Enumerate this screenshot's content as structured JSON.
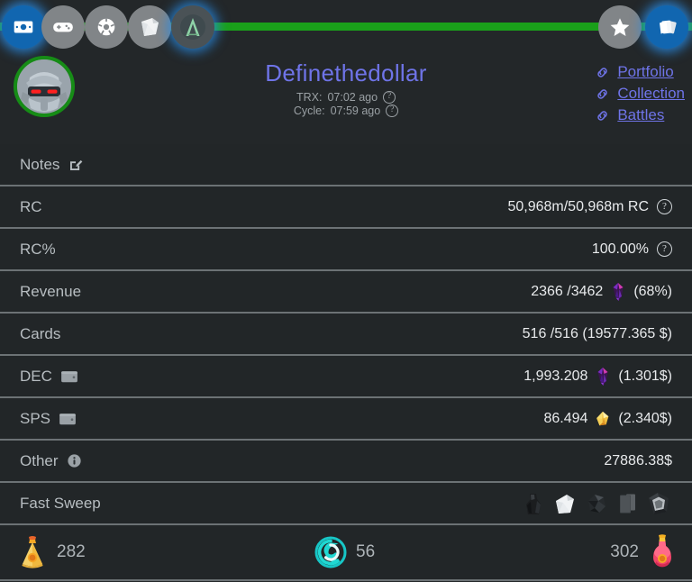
{
  "topbar": {
    "progress_percent": 100,
    "left_icons": [
      {
        "name": "money-icon",
        "label": "Money",
        "state": "active"
      },
      {
        "name": "gamepad-icon",
        "label": "Game",
        "state": "normal"
      },
      {
        "name": "ball-icon",
        "label": "Ball",
        "state": "normal"
      },
      {
        "name": "pack-icon",
        "label": "Pack",
        "state": "normal"
      },
      {
        "name": "alpha-icon",
        "label": "Alpha",
        "state": "glow"
      }
    ],
    "right_icons": [
      {
        "name": "star-icon",
        "label": "Star",
        "state": "normal"
      },
      {
        "name": "cards-icon",
        "label": "Cards",
        "state": "active"
      }
    ]
  },
  "header": {
    "username": "Definethedollar",
    "trx_label": "TRX:",
    "trx_value": "07:02 ago",
    "cycle_label": "Cycle:",
    "cycle_value": "07:59 ago",
    "help_glyph": "?",
    "links": [
      {
        "label": "Portfolio"
      },
      {
        "label": "Collection"
      },
      {
        "label": "Battles"
      }
    ]
  },
  "rows": [
    {
      "label": "Notes",
      "value": ""
    },
    {
      "label": "RC",
      "value": "50,968m/50,968m RC"
    },
    {
      "label": "RC%",
      "value": "100.00%"
    },
    {
      "label": "Revenue",
      "value_pre": "2366 /3462",
      "value_post": "(68%)"
    },
    {
      "label": "Cards",
      "value": "516 /516 (19577.365 $)"
    },
    {
      "label": "DEC",
      "value_pre": "1,993.208",
      "value_post": "(1.301$)"
    },
    {
      "label": "SPS",
      "value_pre": "86.494",
      "value_post": "(2.340$)"
    },
    {
      "label": "Other",
      "value": "27886.38$"
    },
    {
      "label": "Fast Sweep",
      "value": ""
    }
  ],
  "fast_sweep_icons": [
    {
      "name": "potion-dark-icon"
    },
    {
      "name": "white-pack-icon"
    },
    {
      "name": "crumpled-item-icon"
    },
    {
      "name": "card-stack-icon"
    },
    {
      "name": "framed-card-icon"
    }
  ],
  "footer": {
    "left": {
      "icon": "gold-pouch-icon",
      "value": "282"
    },
    "mid": {
      "icon": "teal-vortex-icon",
      "value": "56"
    },
    "right": {
      "icon": "red-potion-icon",
      "value": "302"
    }
  },
  "colors": {
    "background": "#232729",
    "row_background": "#222628",
    "divider": "#6c7275",
    "accent_blue": "#6f74e8",
    "progress_green": "#1aa01a",
    "icon_gray": "#818588",
    "active_blue": "#1166b0",
    "label_text": "#b7bdc1",
    "value_text": "#e8eaec"
  }
}
